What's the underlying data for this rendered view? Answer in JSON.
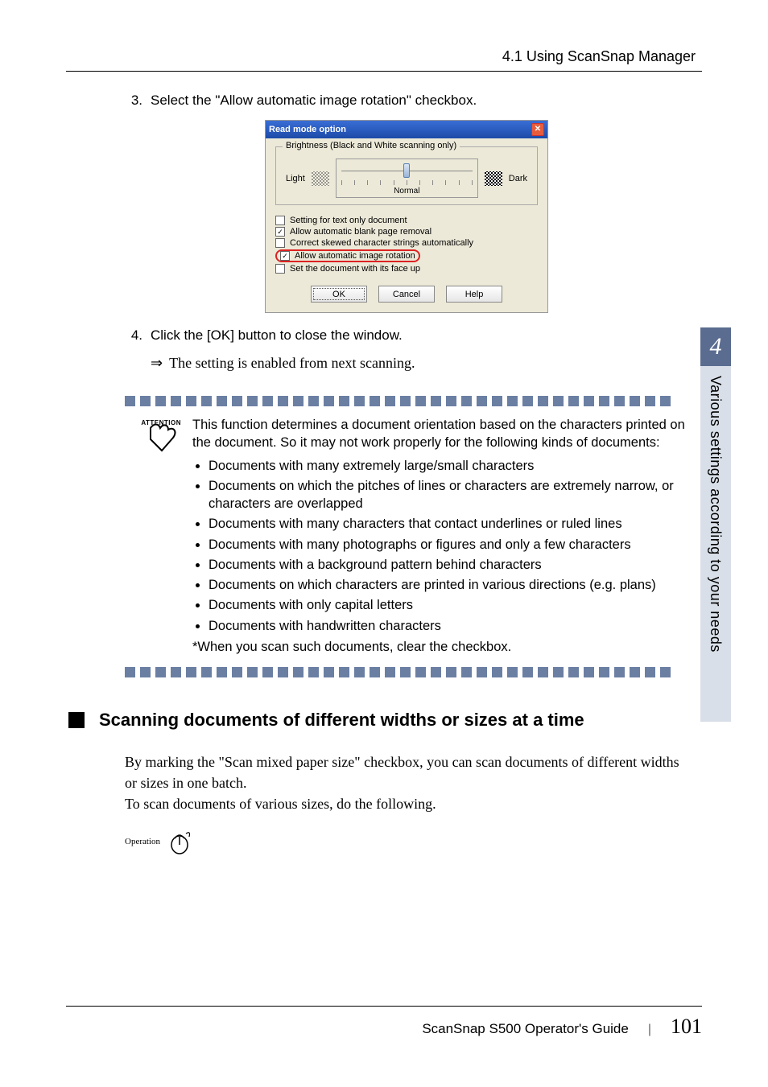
{
  "header": {
    "title": "4.1 Using ScanSnap Manager"
  },
  "steps": {
    "s3": {
      "num": "3.",
      "text": "Select the \"Allow automatic image rotation\" checkbox."
    },
    "s4": {
      "num": "4.",
      "text": "Click the [OK] button to close the window."
    }
  },
  "result_arrow": "⇒",
  "result_text": "The setting is enabled from next scanning.",
  "dialog": {
    "title": "Read mode option",
    "fieldset_legend": "Brightness (Black and White scanning only)",
    "light_label": "Light",
    "dark_label": "Dark",
    "normal_label": "Normal",
    "checks": [
      {
        "label": "Setting for text only document",
        "checked": false,
        "hl": false
      },
      {
        "label": "Allow automatic blank page removal",
        "checked": true,
        "hl": false
      },
      {
        "label": "Correct skewed character strings automatically",
        "checked": false,
        "hl": false
      },
      {
        "label": "Allow automatic image rotation",
        "checked": true,
        "hl": true
      },
      {
        "label": "Set the document with its face up",
        "checked": false,
        "hl": false
      }
    ],
    "btn_ok": "OK",
    "btn_cancel": "Cancel",
    "btn_help": "Help"
  },
  "attention": {
    "label": "ATTENTION",
    "intro": "This function determines a document orientation based on the characters printed on the document. So it may not work properly for the following kinds of documents:",
    "items": [
      "Documents with many extremely large/small characters",
      "Documents on which the pitches of lines or characters are extremely narrow, or characters are overlapped",
      "Documents with many characters that contact underlines or ruled lines",
      "Documents with many photographs or figures and only a few characters",
      "Documents with a background pattern behind characters",
      "Documents on which characters are printed in various directions (e.g. plans)",
      "Documents with only capital letters",
      "Documents with handwritten characters"
    ],
    "footnote": "*When you scan such documents, clear the checkbox."
  },
  "section": {
    "title": "Scanning documents of different widths or sizes at a time",
    "p1": "By marking the \"Scan mixed paper size\" checkbox, you can scan documents of different widths or sizes in one batch.",
    "p2": "To scan documents of various sizes, do the following.",
    "op_label": "Operation"
  },
  "side": {
    "chapter": "4",
    "text": "Various settings according to your needs"
  },
  "footer": {
    "title": "ScanSnap S500 Operator's Guide",
    "page": "101"
  }
}
